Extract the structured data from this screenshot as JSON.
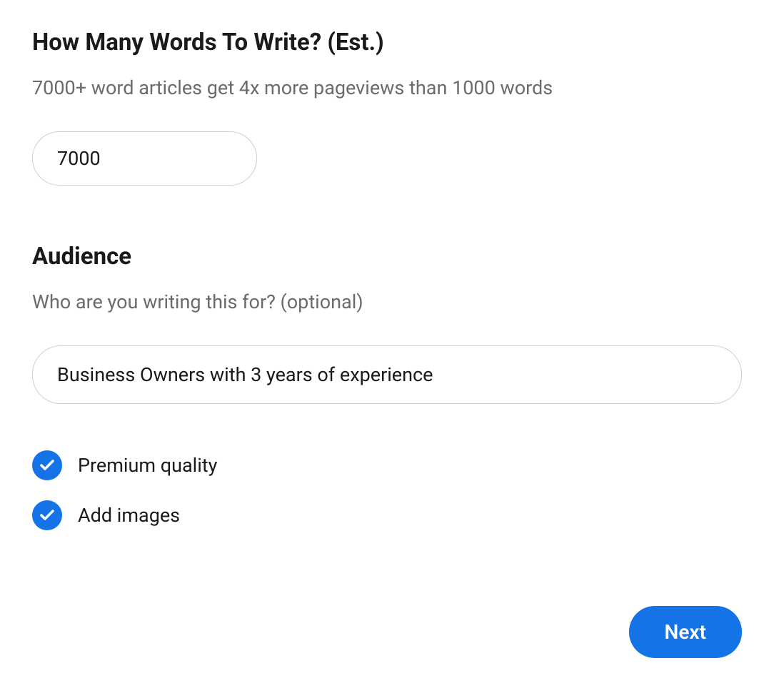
{
  "words_section": {
    "title": "How Many Words To Write? (Est.)",
    "subtitle": "7000+ word articles get 4x more pageviews than 1000 words",
    "value": "7000"
  },
  "audience_section": {
    "title": "Audience",
    "subtitle": "Who are you writing this for? (optional)",
    "value": "Business Owners with 3 years of experience"
  },
  "checkboxes": {
    "premium": {
      "label": "Premium quality",
      "checked": true
    },
    "images": {
      "label": "Add images",
      "checked": true
    }
  },
  "next_button": {
    "label": "Next"
  }
}
